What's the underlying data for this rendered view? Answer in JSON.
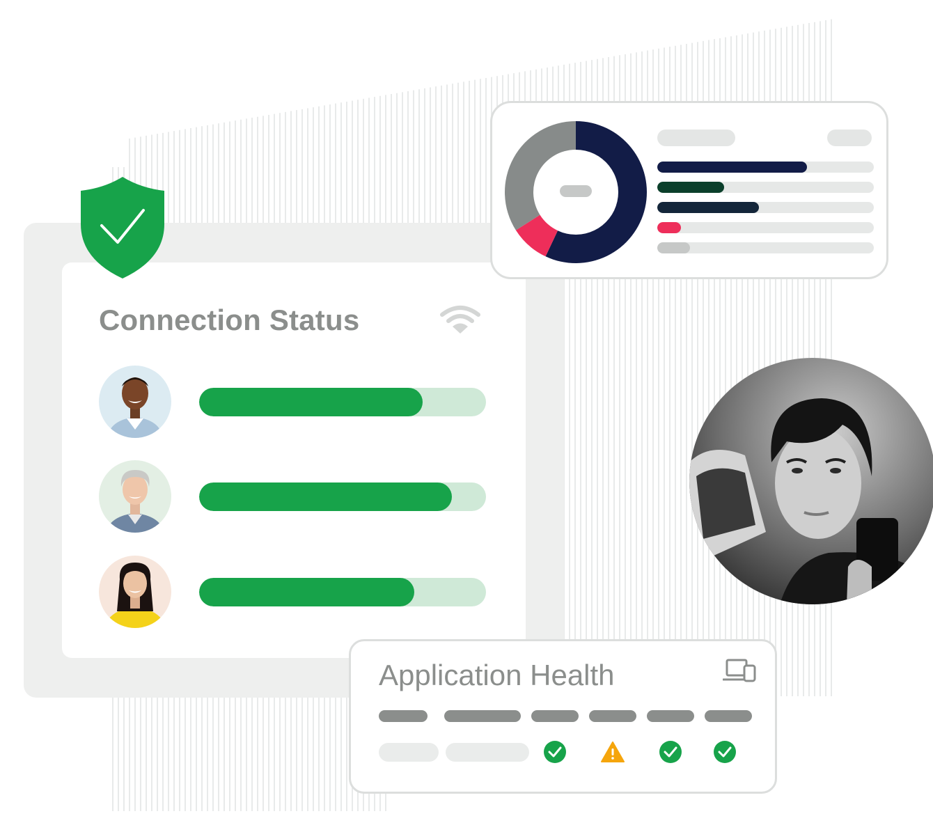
{
  "connection_status": {
    "title": "Connection Status",
    "icon": "wifi-icon",
    "users": [
      {
        "name": "user-1",
        "avatar_bg": "#dcebf2",
        "connection_strength": 0.78
      },
      {
        "name": "user-2",
        "avatar_bg": "#e3efe4",
        "connection_strength": 0.88
      },
      {
        "name": "user-3",
        "avatar_bg": "#f7e6dc",
        "connection_strength": 0.75
      }
    ]
  },
  "shield": {
    "icon": "shield-check-icon",
    "color": "#17a34a"
  },
  "analytics": {
    "donut": [
      {
        "color": "#121c47",
        "share": 0.57
      },
      {
        "color": "#ee2e5a",
        "share": 0.09
      },
      {
        "color": "#878b8a",
        "share": 0.34
      }
    ],
    "rows": [
      {
        "color": "#121c47",
        "fill": 0.69
      },
      {
        "color": "#0b3f2b",
        "fill": 0.31
      },
      {
        "color": "#14263a",
        "fill": 0.47
      },
      {
        "color": "#ee2e5a",
        "fill": 0.11
      },
      {
        "color": "#c6c8c7",
        "fill": 0.15
      }
    ]
  },
  "application_health": {
    "title": "Application Health",
    "icon": "devices-icon",
    "statuses": [
      {
        "icon": "check-circle-icon",
        "color": "#17a34a"
      },
      {
        "icon": "warning-triangle-icon",
        "color": "#f5a50c"
      },
      {
        "icon": "check-circle-icon",
        "color": "#17a34a"
      },
      {
        "icon": "check-circle-icon",
        "color": "#17a34a"
      }
    ]
  },
  "colors": {
    "green": "#17a34a",
    "navy": "#121c47",
    "gray_text": "#8b8e8c"
  }
}
